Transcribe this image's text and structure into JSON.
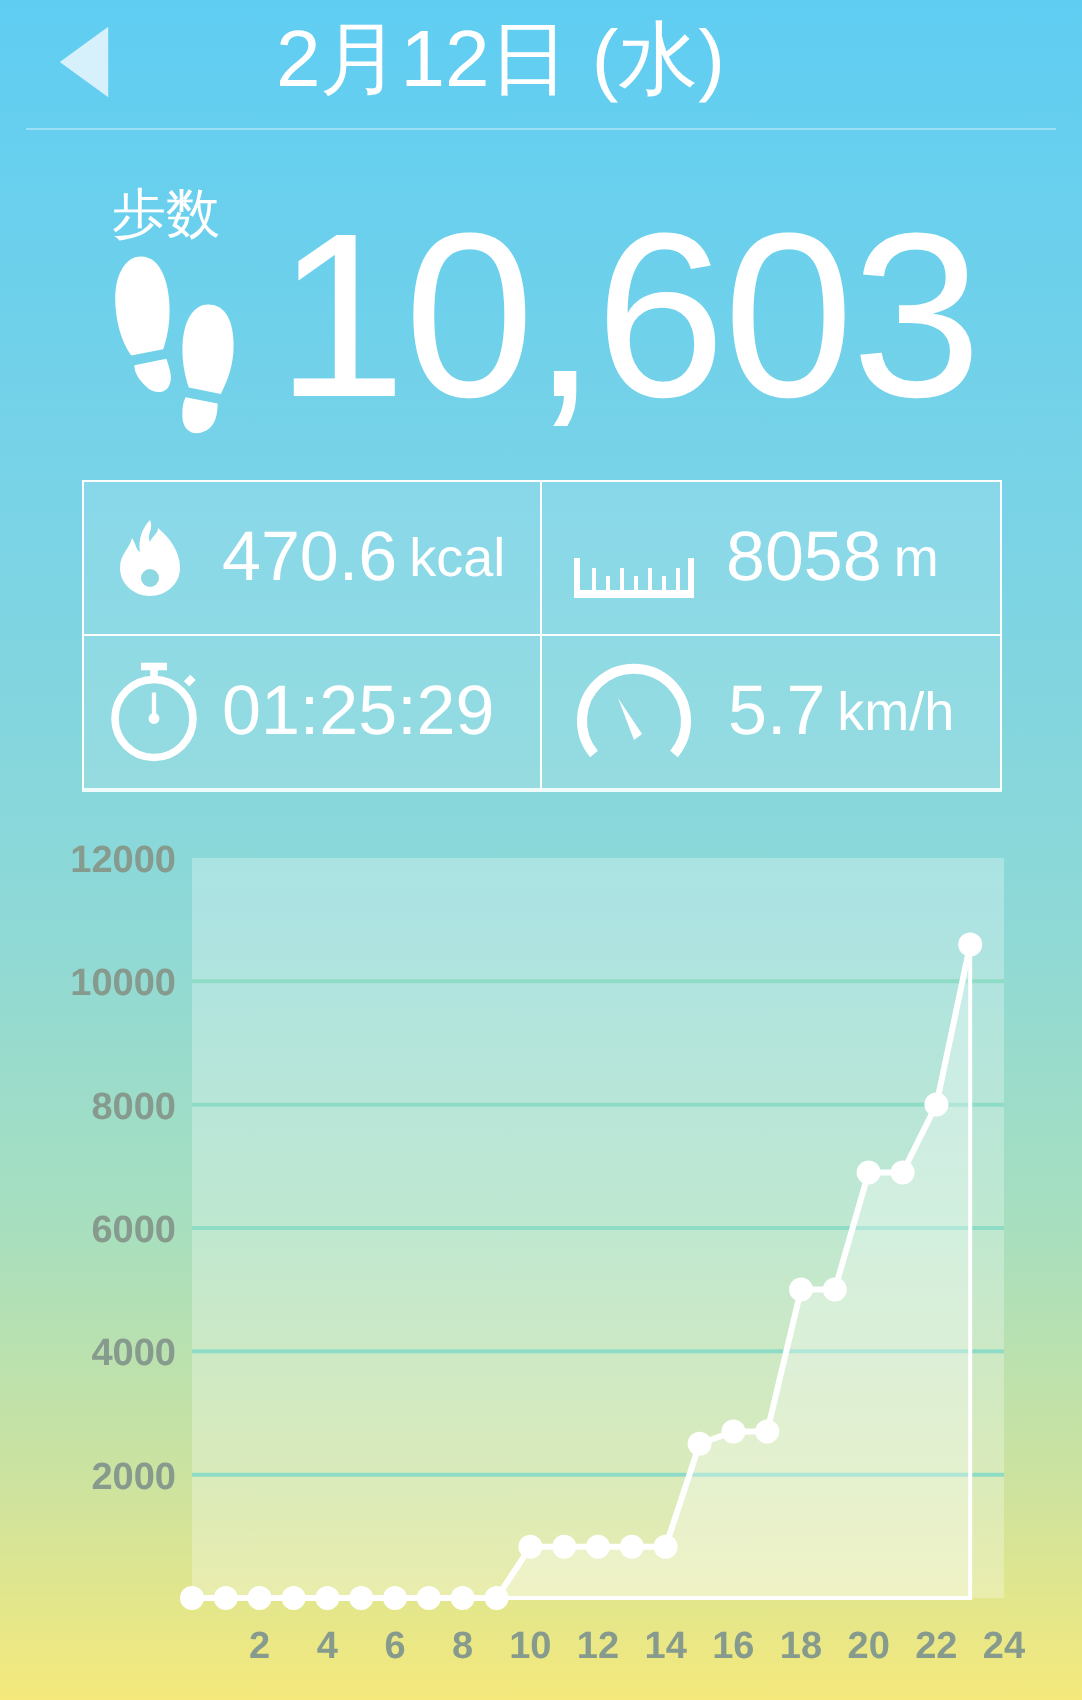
{
  "header": {
    "title": "2月12日 (水)"
  },
  "steps": {
    "label": "歩数",
    "value": "10,603"
  },
  "stats": [
    {
      "kind": "calories",
      "value": "470.6",
      "unit": "kcal"
    },
    {
      "kind": "distance",
      "value": "8058",
      "unit": "m"
    },
    {
      "kind": "time",
      "value": "01:25:29"
    },
    {
      "kind": "speed",
      "value": "5.7",
      "unit": "km/h"
    }
  ],
  "chart_data": {
    "type": "area",
    "x": [
      0,
      1,
      2,
      3,
      4,
      5,
      6,
      7,
      8,
      9,
      10,
      11,
      12,
      13,
      14,
      15,
      16,
      17,
      18,
      19,
      20,
      21,
      22,
      23
    ],
    "series": [
      {
        "color": "#ffffff",
        "values": [
          0,
          0,
          0,
          0,
          0,
          0,
          0,
          0,
          0,
          0,
          830,
          830,
          830,
          830,
          830,
          2500,
          2700,
          2700,
          5000,
          5000,
          6900,
          6900,
          8000,
          10600
        ]
      }
    ],
    "grid": true,
    "xlim": [
      0,
      24
    ],
    "ylim": [
      0,
      12000
    ],
    "xticks": [
      2,
      4,
      6,
      8,
      10,
      12,
      14,
      16,
      18,
      20,
      22,
      24
    ],
    "yticks": [
      2000,
      4000,
      6000,
      8000,
      10000,
      12000
    ]
  }
}
